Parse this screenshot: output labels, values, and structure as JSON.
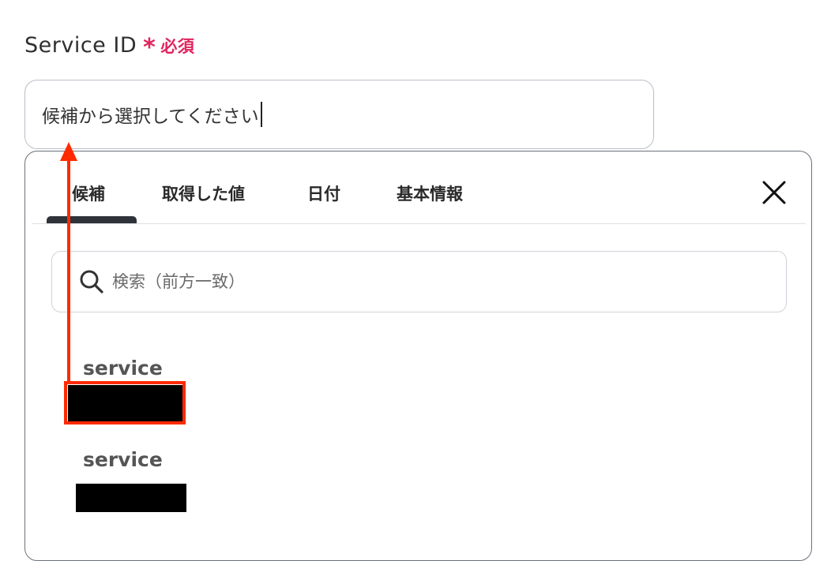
{
  "field": {
    "label": "Service ID",
    "required_mark": "*",
    "required_text": "必須"
  },
  "select": {
    "placeholder": "候補から選択してください"
  },
  "dropdown": {
    "tabs": [
      {
        "label": "候補",
        "active": true
      },
      {
        "label": "取得した値",
        "active": false
      },
      {
        "label": "日付",
        "active": false
      },
      {
        "label": "基本情報",
        "active": false
      }
    ],
    "close_icon": "close-icon",
    "search": {
      "icon": "search-icon",
      "placeholder": "検索（前方一致）"
    },
    "options": [
      {
        "label": "service"
      },
      {
        "label": "service"
      }
    ]
  },
  "colors": {
    "required": "#e0245e",
    "annotation": "#ff2a00",
    "tab_indicator": "#2f3339"
  }
}
